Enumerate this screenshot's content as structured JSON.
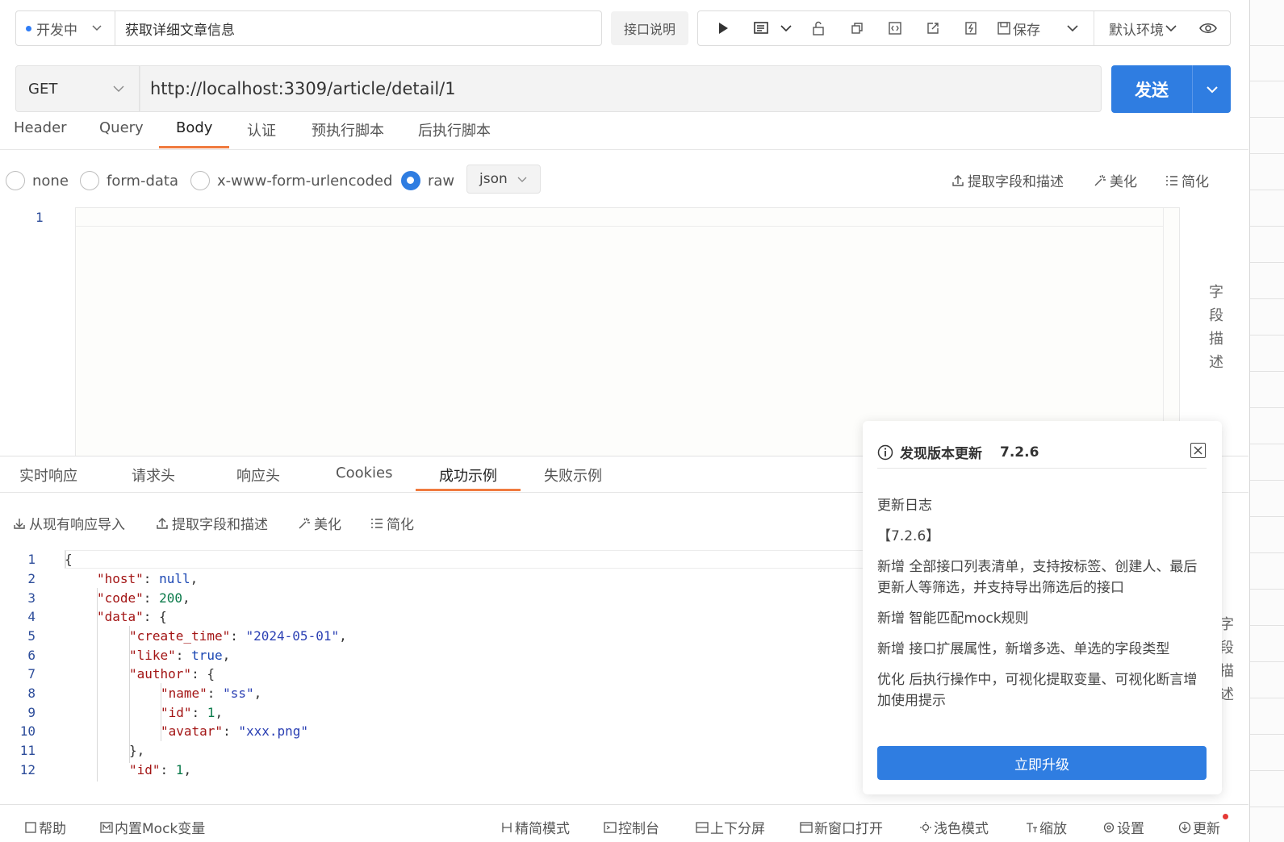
{
  "top": {
    "status": "开发中",
    "api_name": "获取详细文章信息",
    "doc_button": "接口说明",
    "save_label": "保存",
    "env_label": "默认环境"
  },
  "request": {
    "method": "GET",
    "url": "http://localhost:3309/article/detail/1",
    "send_label": "发送"
  },
  "request_tabs": [
    "Header",
    "Query",
    "Body",
    "认证",
    "预执行脚本",
    "后执行脚本"
  ],
  "body_types": [
    "none",
    "form-data",
    "x-www-form-urlencoded",
    "raw"
  ],
  "body_format": "json",
  "body_actions": [
    "提取字段和描述",
    "美化",
    "简化"
  ],
  "field_desc_label": [
    "字",
    "段",
    "描",
    "述"
  ],
  "body_editor": {
    "line_numbers": [
      "1"
    ]
  },
  "response_tabs": [
    "实时响应",
    "请求头",
    "响应头",
    "Cookies",
    "成功示例",
    "失败示例"
  ],
  "response_actions": [
    "从现有响应导入",
    "提取字段和描述",
    "美化",
    "简化"
  ],
  "response_code": {
    "line_numbers": [
      "1",
      "2",
      "3",
      "4",
      "5",
      "6",
      "7",
      "8",
      "9",
      "10",
      "11",
      "12"
    ]
  },
  "bottom_bar": [
    "帮助",
    "内置Mock变量",
    "精简模式",
    "控制台",
    "上下分屏",
    "新窗口打开",
    "浅色模式",
    "缩放",
    "设置",
    "更新"
  ],
  "update_popup": {
    "title": "发现版本更新",
    "version": "7.2.6",
    "log_title": "更新日志",
    "version_tag": "【7.2.6】",
    "items": [
      "新增 全部接口列表清单，支持按标签、创建人、最后更新人等筛选，并支持导出筛选后的接口",
      "新增 智能匹配mock规则",
      "新增 接口扩展属性，新增多选、单选的字段类型",
      "优化 后执行操作中，可视化提取变量、可视化断言增加使用提示"
    ],
    "upgrade_button": "立即升级"
  },
  "colors": {
    "accent": "#2f7de1",
    "tab_active": "#f07b3f"
  }
}
